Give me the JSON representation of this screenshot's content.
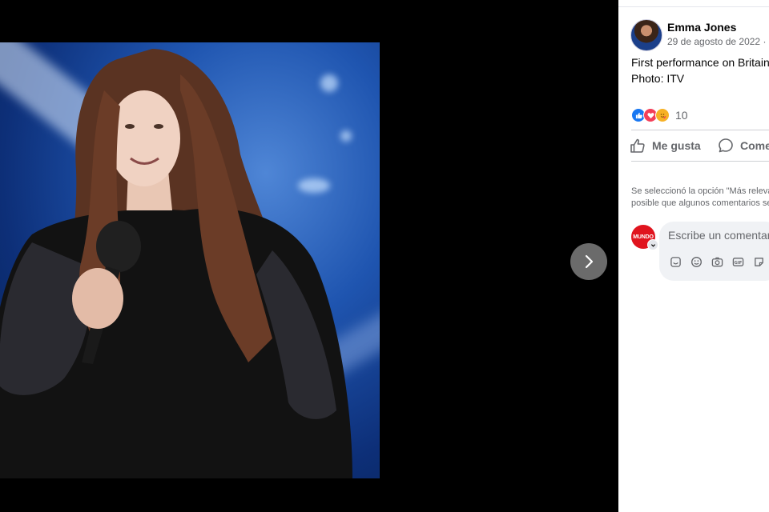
{
  "viewer": {
    "photo_alt": "Photo",
    "next_icon": "chevron-right-icon"
  },
  "post": {
    "author_name": "Emma Jones",
    "date": "29 de agosto de 2022 ·",
    "caption_line1": "First performance on Britain",
    "caption_line2": "Photo: ITV",
    "reaction_icons": [
      "like-icon",
      "love-icon",
      "care-icon"
    ],
    "reaction_count": "10",
    "like_label": "Me gusta",
    "comment_label": "Comentar"
  },
  "comments": {
    "relevance_line1": "Se seleccionó la opción \"Más relevantes\"",
    "relevance_line2": "posible que algunos comentarios se",
    "my_avatar_text": "MUNDO",
    "input_placeholder": "Escribe un comentario...",
    "tool_icons": [
      "sticker-icon",
      "emoji-icon",
      "camera-icon",
      "gif-icon",
      "avatar-sticker-icon"
    ]
  },
  "colors": {
    "background": "#000000",
    "panel": "#ffffff",
    "secondary_text": "#65676b",
    "like_blue": "#1877f2",
    "love_red": "#f33e58"
  }
}
